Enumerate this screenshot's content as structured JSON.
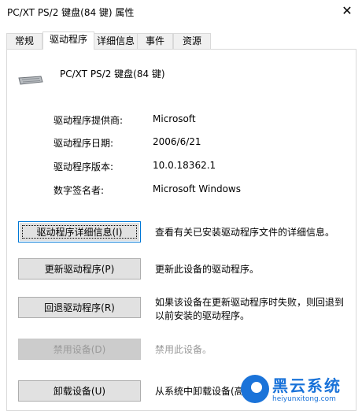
{
  "window": {
    "title": "PC/XT PS/2 键盘(84 键) 属性",
    "close_glyph": "✕"
  },
  "tabs": [
    {
      "label": "常规"
    },
    {
      "label": "驱动程序"
    },
    {
      "label": "详细信息"
    },
    {
      "label": "事件"
    },
    {
      "label": "资源"
    }
  ],
  "active_tab": "驱动程序",
  "device": {
    "name": "PC/XT PS/2 键盘(84 键)",
    "icon": "keyboard-icon"
  },
  "driver_info": [
    {
      "label": "驱动程序提供商:",
      "value": "Microsoft"
    },
    {
      "label": "驱动程序日期:",
      "value": "2006/6/21"
    },
    {
      "label": "驱动程序版本:",
      "value": "10.0.18362.1"
    },
    {
      "label": "数字签名者:",
      "value": "Microsoft Windows"
    }
  ],
  "actions": [
    {
      "label": "驱动程序详细信息(I)",
      "desc": "查看有关已安装驱动程序文件的详细信息。",
      "enabled": true
    },
    {
      "label": "更新驱动程序(P)",
      "desc": "更新此设备的驱动程序。",
      "enabled": true
    },
    {
      "label": "回退驱动程序(R)",
      "desc": "如果该设备在更新驱动程序时失败，则回退到以前安装的驱动程序。",
      "enabled": true
    },
    {
      "label": "禁用设备(D)",
      "desc": "禁用此设备。",
      "enabled": false
    },
    {
      "label": "卸载设备(U)",
      "desc": "从系统中卸载设备(高级)。",
      "enabled": true
    }
  ],
  "watermark": {
    "text": "黑云系统",
    "url": "heiyunxitong.com",
    "color": "#1a73d9"
  }
}
